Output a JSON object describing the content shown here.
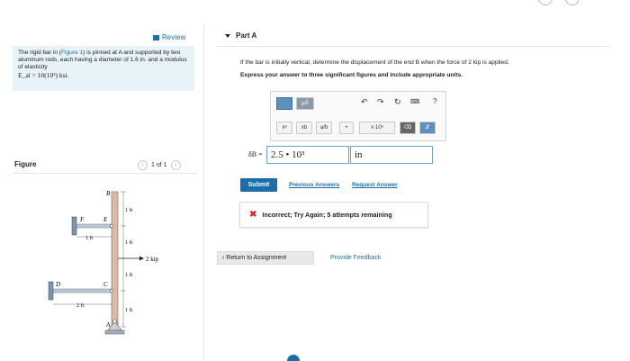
{
  "left": {
    "review_label": "Review",
    "problem_prefix": "The rigid bar in (",
    "problem_link": "Figure 1",
    "problem_rest": ") is pinned at A and supported by two aluminum rods, each having a diameter of 1.6 in. and a modulus of elasticity",
    "problem_formula": "E_al = 10(10³) ksi.",
    "figure_title": "Figure",
    "pager_text": "1 of 1",
    "figure_labels": {
      "B": "B",
      "E": "E",
      "F": "F",
      "C": "C",
      "D": "D",
      "A": "A",
      "dim_1ft_a": "1 ft",
      "dim_1ft_b": "1 ft",
      "dim_1ft_c": "1 ft",
      "dim_1ft_d": "1 ft",
      "dim_1ft_h": "1 ft",
      "dim_2ft_h": "2 ft",
      "load": "2 kip"
    }
  },
  "part": {
    "title": "Part A",
    "question": "If the bar is initially vertical, determine the displacement of the end B when the force of 2 kip is applied.",
    "instruction": "Express your answer to three significant figures and include appropriate units.",
    "toolbar": {
      "mu_label": "μÅ",
      "power": "xᵃ",
      "subscript": "xb",
      "fraction": "a/b",
      "dot": "•",
      "sci": "x·10ⁿ",
      "help": "?"
    },
    "answer_label": "δB =",
    "answer_value": "2.5 • 10³",
    "unit_value": "in",
    "submit_label": "Submit",
    "prev_answers": "Previous Answers",
    "request_answer": "Request Answer",
    "feedback_text": "Incorrect; Try Again; 5 attempts remaining",
    "return_label": "Return to Assignment",
    "provide_feedback": "Provide Feedback"
  },
  "colors": {
    "accent": "#1b6fa8",
    "error": "#d0312d",
    "problem_bg": "#e7f3f8"
  }
}
